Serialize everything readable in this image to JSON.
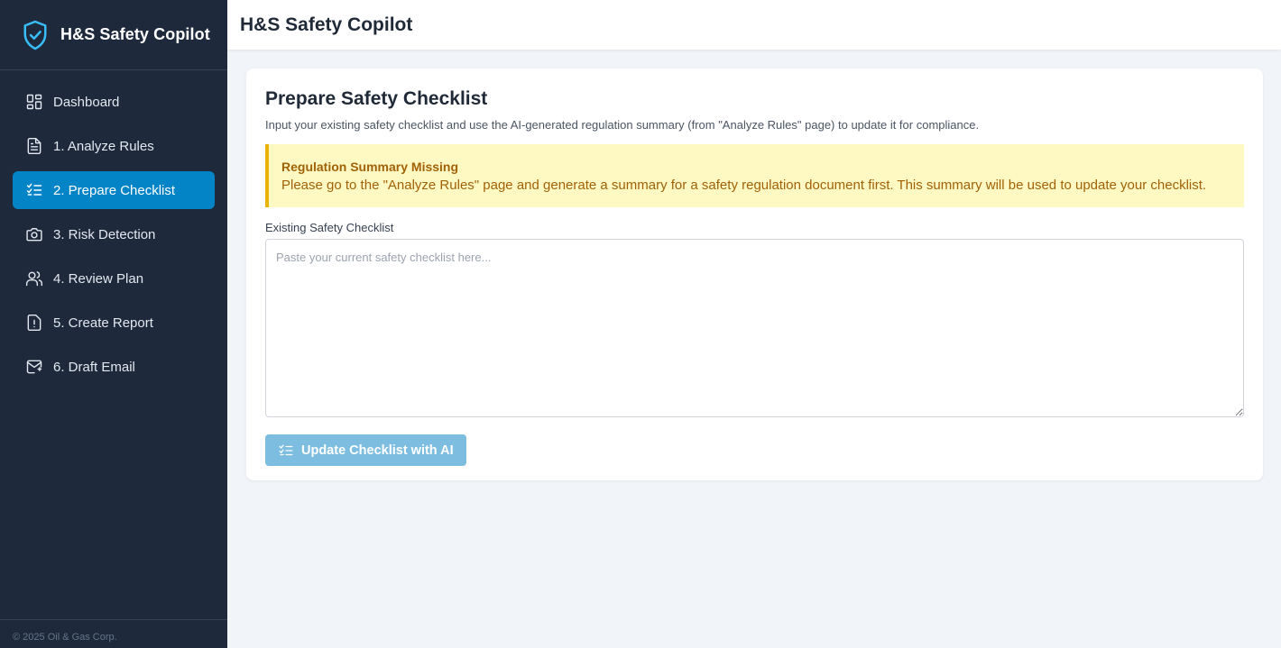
{
  "app": {
    "name": "H&S Safety Copilot",
    "logo_icon": "shield-check-icon",
    "accent_color": "#0284c7"
  },
  "sidebar": {
    "items": [
      {
        "label": "Dashboard",
        "icon": "dashboard-icon",
        "active": false
      },
      {
        "label": "1. Analyze Rules",
        "icon": "document-icon",
        "active": false
      },
      {
        "label": "2. Prepare Checklist",
        "icon": "checklist-icon",
        "active": true
      },
      {
        "label": "3. Risk Detection",
        "icon": "camera-icon",
        "active": false
      },
      {
        "label": "4. Review Plan",
        "icon": "users-icon",
        "active": false
      },
      {
        "label": "5. Create Report",
        "icon": "alert-document-icon",
        "active": false
      },
      {
        "label": "6. Draft Email",
        "icon": "mail-icon",
        "active": false
      }
    ],
    "footer": "© 2025 Oil & Gas Corp."
  },
  "header": {
    "title": "H&S Safety Copilot"
  },
  "main": {
    "title": "Prepare Safety Checklist",
    "description": "Input your existing safety checklist and use the AI-generated regulation summary (from \"Analyze Rules\" page) to update it for compliance.",
    "alert": {
      "title": "Regulation Summary Missing",
      "text": "Please go to the \"Analyze Rules\" page and generate a summary for a safety regulation document first. This summary will be used to update your checklist."
    },
    "checklist_field": {
      "label": "Existing Safety Checklist",
      "placeholder": "Paste your current safety checklist here...",
      "value": ""
    },
    "update_button": {
      "label": "Update Checklist with AI",
      "icon": "checklist-icon"
    }
  }
}
